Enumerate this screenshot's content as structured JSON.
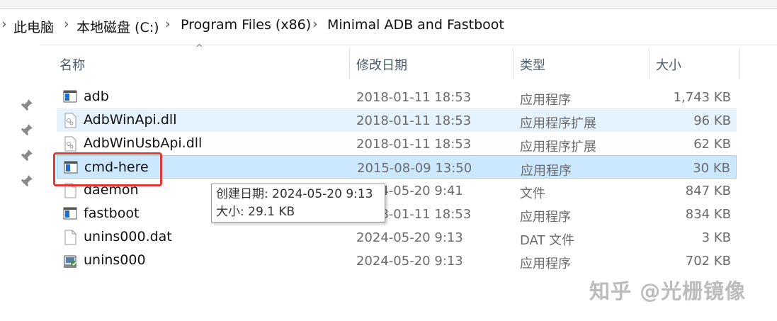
{
  "breadcrumb": {
    "items": [
      "此电脑",
      "本地磁盘 (C:)",
      "Program Files (x86)",
      "Minimal ADB and Fastboot"
    ],
    "separator": "›"
  },
  "columns": {
    "name": "名称",
    "date": "修改日期",
    "type": "类型",
    "size": "大小",
    "sort_indicator": "^"
  },
  "files": [
    {
      "name": "adb",
      "date": "2018-01-11 18:53",
      "type": "应用程序",
      "size": "1,743 KB",
      "icon": "exe-icon"
    },
    {
      "name": "AdbWinApi.dll",
      "date": "2018-01-11 18:53",
      "type": "应用程序扩展",
      "size": "96 KB",
      "icon": "dll-icon"
    },
    {
      "name": "AdbWinUsbApi.dll",
      "date": "2018-01-11 18:53",
      "type": "应用程序扩展",
      "size": "62 KB",
      "icon": "dll-icon"
    },
    {
      "name": "cmd-here",
      "date": "2015-08-09 13:50",
      "type": "应用程序",
      "size": "30 KB",
      "icon": "exe-icon"
    },
    {
      "name": "daemon",
      "date": "2024-05-20 9:41",
      "type": "文件",
      "size": "847 KB",
      "icon": "file-icon"
    },
    {
      "name": "fastboot",
      "date": "2018-01-11 18:53",
      "type": "应用程序",
      "size": "834 KB",
      "icon": "exe-icon"
    },
    {
      "name": "unins000.dat",
      "date": "2024-05-20 9:13",
      "type": "DAT 文件",
      "size": "3 KB",
      "icon": "file-icon"
    },
    {
      "name": "unins000",
      "date": "2024-05-20 9:13",
      "type": "应用程序",
      "size": "702 KB",
      "icon": "installer-icon"
    }
  ],
  "tooltip": {
    "line1": "创建日期: 2024-05-20 9:13",
    "line2": "大小: 29.1 KB"
  },
  "watermark": "知乎 @光栅镜像",
  "colors": {
    "selection": "#cce8ff",
    "hover": "#e5f3ff",
    "annotation": "#e53935"
  }
}
